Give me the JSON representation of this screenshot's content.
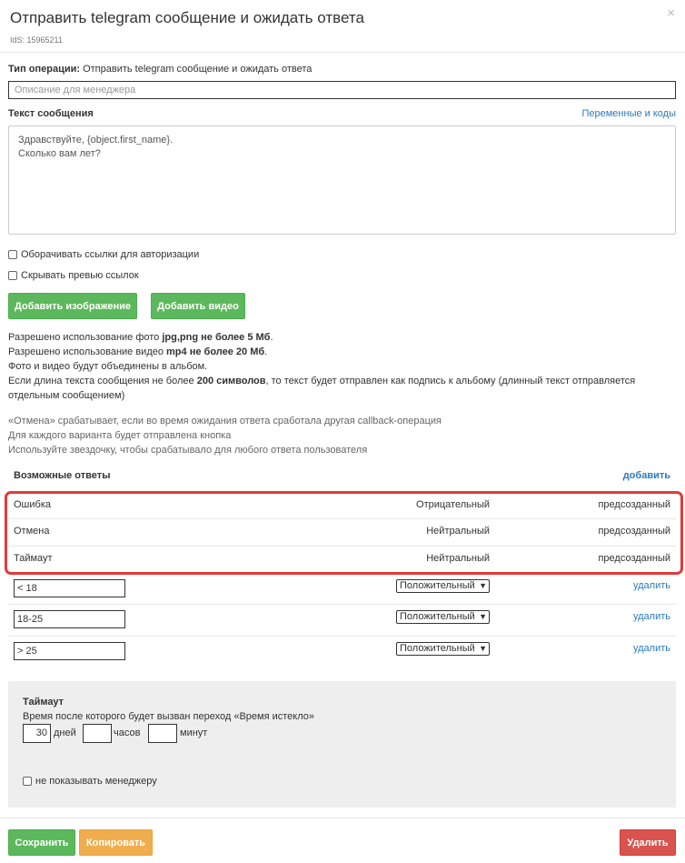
{
  "header": {
    "title": "Отправить telegram сообщение и ожидать ответа",
    "ids": "IdS: 15965211",
    "close": "×"
  },
  "operation": {
    "label": "Тип операции:",
    "value": " Отправить telegram сообщение и ожидать ответа",
    "description_placeholder": "Описание для менеджера"
  },
  "message": {
    "label": "Текст сообщения",
    "vars_link": "Переменные и коды",
    "text": "Здравствуйте, {object.first_name}.\nСколько вам лет?"
  },
  "options": {
    "wrap_links": "Оборачивать ссылки для авторизации",
    "hide_preview": "Скрывать превью ссылок"
  },
  "media": {
    "add_image": "Добавить изображение",
    "add_video": "Добавить видео"
  },
  "info": {
    "l1a": "Разрешено использование фото ",
    "l1b": "jpg,png не более 5 Мб",
    "l1c": ".",
    "l2a": "Разрешено использование видео ",
    "l2b": "mp4 не более 20 Мб",
    "l2c": ".",
    "l3": "Фото и видео будут объединены в альбом.",
    "l4a": "Если длина текста сообщения не более ",
    "l4b": "200 символов",
    "l4c": ", то текст будет отправлен как подпись к альбому (длинный текст отправляется",
    "l5": "отдельным сообщением)"
  },
  "notes": {
    "n1": "«Отмена» срабатывает, если во время ожидания ответа сработала другая callback-операция",
    "n2": "Для каждого варианта будет отправлена кнопка",
    "n3": "Используйте звездочку, чтобы срабатывало для любого ответа пользователя"
  },
  "answers": {
    "title": "Возможные ответы",
    "add": "добавить",
    "predefined": [
      {
        "name": "Ошибка",
        "type": "Отрицательный",
        "status": "предсозданный"
      },
      {
        "name": "Отмена",
        "type": "Нейтральный",
        "status": "предсозданный"
      },
      {
        "name": "Таймаут",
        "type": "Нейтральный",
        "status": "предсозданный"
      }
    ],
    "custom": [
      {
        "value": "< 18",
        "type": "Положительный",
        "delete": "удалить"
      },
      {
        "value": "18-25",
        "type": "Положительный",
        "delete": "удалить"
      },
      {
        "value": "> 25",
        "type": "Положительный",
        "delete": "удалить"
      }
    ]
  },
  "timeout": {
    "title": "Таймаут",
    "desc": "Время после которого будет вызван переход «Время истекло»",
    "days_value": "30",
    "days_label": "дней",
    "hours_value": "",
    "hours_label": "часов",
    "minutes_value": "",
    "minutes_label": "минут",
    "hide_manager": "не показывать менеджеру"
  },
  "footer": {
    "save": "Сохранить",
    "copy": "Копировать",
    "delete": "Удалить"
  },
  "colors": {
    "green": "#5cb85c",
    "orange": "#f0ad4e",
    "red": "#d9534f",
    "link": "#2a7ac0",
    "highlight": "#e03a3a"
  }
}
